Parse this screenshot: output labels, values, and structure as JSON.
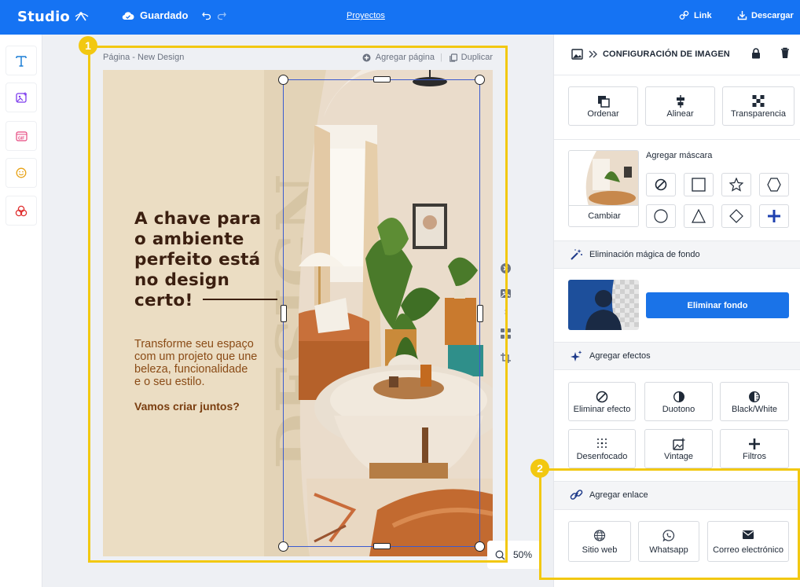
{
  "topbar": {
    "brand": "Studio",
    "saved": "Guardado",
    "projects": "Proyectos",
    "link": "Link",
    "download": "Descargar"
  },
  "leftbar": {
    "tools": [
      "text-icon",
      "image-add-icon",
      "gif-icon",
      "emoji-icon",
      "shapes-icon"
    ]
  },
  "page": {
    "name": "Página - New Design",
    "add_page": "Agregar página",
    "duplicate": "Duplicar"
  },
  "poster": {
    "headline": [
      "A chave para",
      "o ambiente",
      "perfeito está",
      "no design",
      "certo!"
    ],
    "body": [
      "Transforme seu espaço",
      "com um projeto que une",
      "beleza, funcionalidade",
      "e o seu estilo."
    ],
    "cta": "Vamos criar juntos?",
    "watermark": "DESIGN"
  },
  "zoom": "50%",
  "callouts": [
    "1",
    "2"
  ],
  "panel": {
    "title": "CONFIGURACIÓN DE IMAGEN",
    "arrange": [
      "Ordenar",
      "Alinear",
      "Transparencia"
    ],
    "mask_label": "Agregar máscara",
    "change": "Cambiar",
    "bg_removal": "Eliminación mágica de fondo",
    "remove_bg_btn": "Eliminar fondo",
    "effects_label": "Agregar efectos",
    "effects": [
      "Eliminar efecto",
      "Duotono",
      "Black/White",
      "Desenfocado",
      "Vintage",
      "Filtros"
    ],
    "link_label": "Agregar enlace",
    "links": [
      "Sitio web",
      "Whatsapp",
      "Correo electrónico"
    ]
  },
  "colors": {
    "accent": "#1573f3",
    "callout": "#f2c811",
    "headline": "#3b1f10",
    "body": "#8a4b16"
  }
}
